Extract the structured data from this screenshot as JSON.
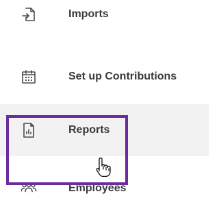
{
  "nav": {
    "items": [
      {
        "label": "Imports",
        "icon": "import-icon"
      },
      {
        "label": "Set up Contributions",
        "icon": "calendar-icon"
      },
      {
        "label": "Reports",
        "icon": "report-icon"
      },
      {
        "label": "Employees",
        "icon": "employees-icon"
      }
    ]
  },
  "colors": {
    "text": "#3a3a3a",
    "icon": "#4a4a4a",
    "highlight_border": "#6b2d9e",
    "selected_background": "#f2f2f2"
  }
}
